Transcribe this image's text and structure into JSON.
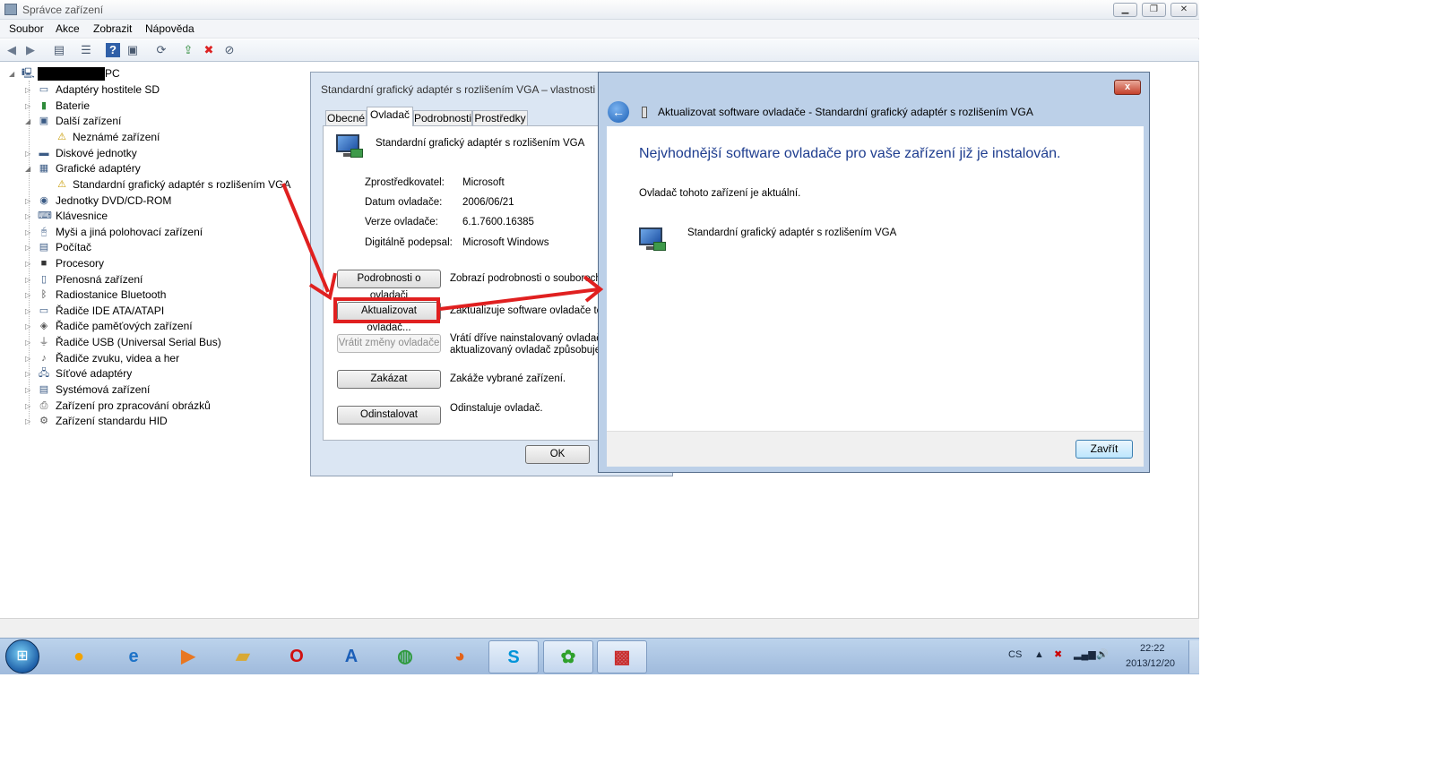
{
  "window": {
    "title": "Správce zařízení",
    "controls": {
      "minimize": "▁",
      "maximize": "❐",
      "close": "✕"
    }
  },
  "menu": [
    "Soubor",
    "Akce",
    "Zobrazit",
    "Nápověda"
  ],
  "toolbar_icons": [
    "back-icon",
    "forward-icon",
    "tree-view-icon",
    "properties-icon",
    "help-icon",
    "action-icon",
    "scan-hardware-icon",
    "update-driver-icon",
    "uninstall-icon",
    "disable-icon"
  ],
  "tree": {
    "root": "PC",
    "categories": [
      {
        "label": "Adaptéry hostitele SD",
        "icon": "sd-host-icon"
      },
      {
        "label": "Baterie",
        "icon": "battery-icon"
      },
      {
        "label": "Další zařízení",
        "icon": "other-devices-icon"
      },
      {
        "label": "Neznámé zařízení",
        "icon": "warning-device-icon",
        "child": true
      },
      {
        "label": "Diskové jednotky",
        "icon": "disk-icon"
      },
      {
        "label": "Grafické adaptéry",
        "icon": "display-adapter-icon"
      },
      {
        "label": "Standardní grafický adaptér s rozlišením VGA",
        "icon": "warning-display-icon",
        "child": true
      },
      {
        "label": "Jednotky DVD/CD-ROM",
        "icon": "dvd-icon"
      },
      {
        "label": "Klávesnice",
        "icon": "keyboard-icon"
      },
      {
        "label": "Myši a jiná polohovací zařízení",
        "icon": "mouse-icon"
      },
      {
        "label": "Počítač",
        "icon": "computer-icon"
      },
      {
        "label": "Procesory",
        "icon": "processor-icon"
      },
      {
        "label": "Přenosná zařízení",
        "icon": "portable-device-icon"
      },
      {
        "label": "Radiostanice Bluetooth",
        "icon": "bluetooth-icon"
      },
      {
        "label": "Řadiče IDE ATA/ATAPI",
        "icon": "ide-icon"
      },
      {
        "label": "Řadiče paměťových zařízení",
        "icon": "storage-controller-icon"
      },
      {
        "label": "Řadiče USB (Universal Serial Bus)",
        "icon": "usb-icon"
      },
      {
        "label": "Řadiče zvuku, videa a her",
        "icon": "sound-icon"
      },
      {
        "label": "Síťové adaptéry",
        "icon": "network-icon"
      },
      {
        "label": "Systémová zařízení",
        "icon": "system-icon"
      },
      {
        "label": "Zařízení pro zpracování obrázků",
        "icon": "imaging-icon"
      },
      {
        "label": "Zařízení standardu HID",
        "icon": "hid-icon"
      }
    ]
  },
  "properties": {
    "title": "Standardní grafický adaptér s rozlišením VGA – vlastnosti",
    "tabs": [
      "Obecné",
      "Ovladač",
      "Podrobnosti",
      "Prostředky"
    ],
    "active_tab": "Ovladač",
    "device_name": "Standardní grafický adaptér s rozlišením VGA",
    "fields": [
      {
        "label": "Zprostředkovatel:",
        "value": "Microsoft"
      },
      {
        "label": "Datum ovladače:",
        "value": "2006/06/21"
      },
      {
        "label": "Verze ovladače:",
        "value": "6.1.7600.16385"
      },
      {
        "label": "Digitálně podepsal:",
        "value": "Microsoft Windows"
      }
    ],
    "buttons": [
      {
        "label": "Podrobnosti o ovladači",
        "desc": "Zobrazí podrobnosti o souborech ov"
      },
      {
        "label": "Aktualizovat ovladač...",
        "desc": "Zaktualizuje software ovladače toho"
      },
      {
        "label": "Vrátit změny ovladače",
        "desc": "Vrátí dříve nainstalovaný ovladač, p",
        "desc2": "aktualizovaný ovladač způsobuje pro",
        "disabled": true
      },
      {
        "label": "Zakázat",
        "desc": "Zakáže vybrané zařízení."
      },
      {
        "label": "Odinstalovat",
        "desc": "Odinstaluje ovladač."
      }
    ],
    "ok_label": "OK"
  },
  "wizard": {
    "title": "Aktualizovat software ovladače - Standardní grafický adaptér s rozlišením VGA",
    "close_label": "x",
    "heading": "Nejvhodnější software ovladače pro vaše zařízení již je instalován.",
    "message": "Ovladač tohoto zařízení je aktuální.",
    "device_name": "Standardní grafický adaptér s rozlišením VGA",
    "close_button": "Zavřít"
  },
  "annotation": {
    "arrow_color": "#e02020"
  },
  "taskbar": {
    "apps": [
      "explorer-ball-icon",
      "internet-explorer-icon",
      "media-player-icon",
      "folder-icon",
      "opera-icon",
      "app-a-icon",
      "chrome-icon",
      "firefox-icon",
      "skype-icon",
      "icq-icon",
      "toolbox-icon"
    ],
    "language": "CS",
    "time": "22:22",
    "date": "2013/12/20"
  }
}
